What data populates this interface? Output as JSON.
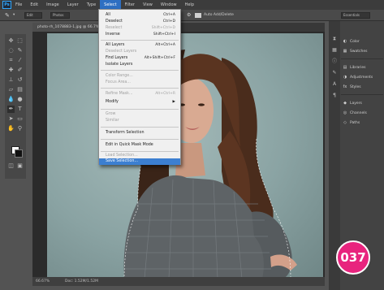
{
  "app": {
    "logo_text": "Ps"
  },
  "menubar": {
    "items": [
      "File",
      "Edit",
      "Image",
      "Layer",
      "Type",
      "Select",
      "Filter",
      "View",
      "Window",
      "Help"
    ],
    "active_item": "Select"
  },
  "options_bar": {
    "mode_value": "Edit",
    "mode2_value": "Photos",
    "auto_label": "Auto Add/Delete",
    "workspace_value": "Essentials"
  },
  "document": {
    "tab_label": "photo-rh_1078883-1.jpg @ 66.7% ...",
    "zoom": "66.67%",
    "doc_info": "Doc: 1.52M/1.52M"
  },
  "select_menu": {
    "items": [
      {
        "label": "All",
        "shortcut": "Ctrl+A",
        "disabled": false
      },
      {
        "label": "Deselect",
        "shortcut": "Ctrl+D",
        "disabled": false
      },
      {
        "label": "Reselect",
        "shortcut": "Shift+Ctrl+D",
        "disabled": true
      },
      {
        "label": "Inverse",
        "shortcut": "Shift+Ctrl+I",
        "disabled": false
      },
      {
        "label": "All Layers",
        "shortcut": "Alt+Ctrl+A",
        "disabled": false
      },
      {
        "label": "Deselect Layers",
        "shortcut": "",
        "disabled": true
      },
      {
        "label": "Find Layers",
        "shortcut": "Alt+Shift+Ctrl+F",
        "disabled": false
      },
      {
        "label": "Isolate Layers",
        "shortcut": "",
        "disabled": false
      },
      {
        "label": "Color Range...",
        "shortcut": "",
        "disabled": true
      },
      {
        "label": "Focus Area...",
        "shortcut": "",
        "disabled": true
      },
      {
        "label": "Refine Mask...",
        "shortcut": "Alt+Ctrl+R",
        "disabled": true
      },
      {
        "label": "Modify",
        "shortcut": "▶",
        "disabled": false
      },
      {
        "label": "Grow",
        "shortcut": "",
        "disabled": true
      },
      {
        "label": "Similar",
        "shortcut": "",
        "disabled": true
      },
      {
        "label": "Transform Selection",
        "shortcut": "",
        "disabled": false
      },
      {
        "label": "Edit in Quick Mask Mode",
        "shortcut": "",
        "disabled": false
      },
      {
        "label": "Load Selection...",
        "shortcut": "",
        "disabled": true
      },
      {
        "label": "Save Selection...",
        "shortcut": "",
        "disabled": false,
        "highlighted": true
      }
    ]
  },
  "panels": {
    "group1": [
      "Color",
      "Swatches"
    ],
    "group2": [
      "Libraries",
      "Adjustments",
      "Styles"
    ],
    "group3": [
      "Layers",
      "Channels",
      "Paths"
    ]
  },
  "badge": {
    "text": "037"
  },
  "colors": {
    "menu_highlight": "#2e6fc2",
    "dropdown_highlight": "#3c7fd1",
    "badge": "#e8247e",
    "photo_bg": "#9ab2b1"
  }
}
